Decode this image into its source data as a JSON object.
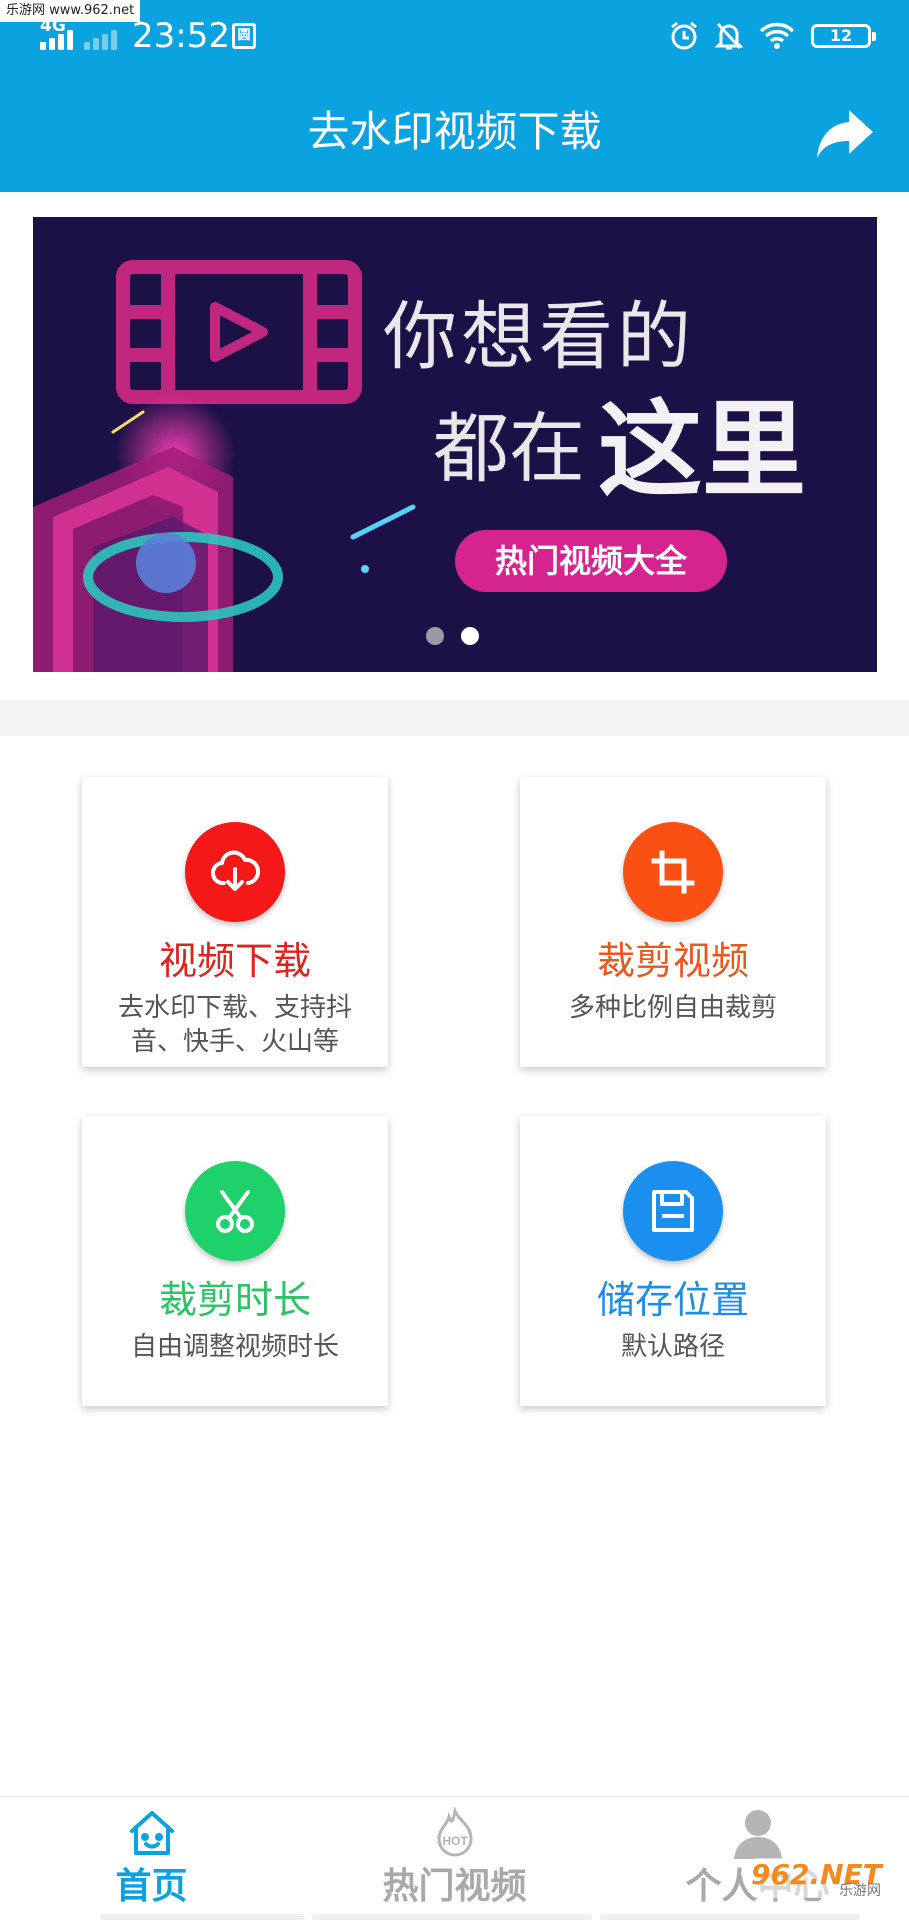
{
  "watermark": {
    "top_left": "乐游网 www.962.net",
    "bottom_logo": "962.NET",
    "bottom_sub": "乐游网"
  },
  "status_bar": {
    "network": "4G",
    "time": "23:52",
    "battery": "12"
  },
  "header": {
    "title": "去水印视频下载"
  },
  "banner": {
    "line1": "你想看的",
    "line2a": "都在",
    "line2b": "这里",
    "pill": "热门视频大全",
    "page_count": 2,
    "active_page": 2
  },
  "features": [
    {
      "title": "视频下载",
      "desc": "去水印下载、支持抖音、快手、火山等",
      "color": "#d7261e",
      "icon": "cloud-download-icon"
    },
    {
      "title": "裁剪视频",
      "desc": "多种比例自由裁剪",
      "color": "#e8571c",
      "icon": "crop-icon"
    },
    {
      "title": "裁剪时长",
      "desc": "自由调整视频时长",
      "color": "#2cc266",
      "icon": "scissors-icon"
    },
    {
      "title": "储存位置",
      "desc": "默认路径",
      "color": "#1d8fe0",
      "icon": "save-icon"
    }
  ],
  "bottom_nav": [
    {
      "label": "首页",
      "icon": "home-icon",
      "active": true
    },
    {
      "label": "热门视频",
      "icon": "hot-icon",
      "active": false
    },
    {
      "label": "个人中心",
      "icon": "user-icon",
      "active": false
    }
  ],
  "colors": {
    "primary": "#0aa3e0",
    "banner_bg": "#1c1147",
    "pill": "#d6248e"
  }
}
